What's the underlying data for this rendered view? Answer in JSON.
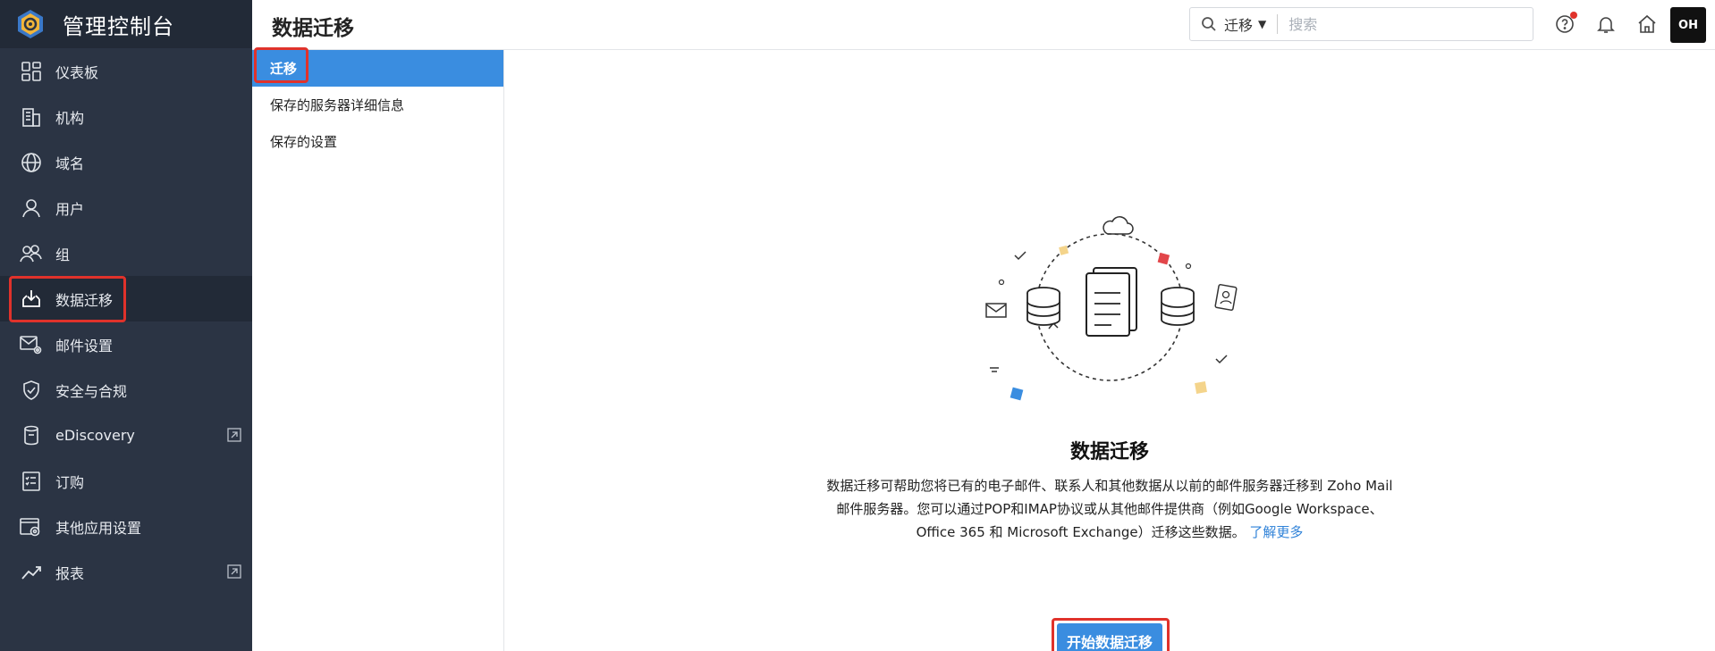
{
  "brand": {
    "title": "管理控制台"
  },
  "sidebar": {
    "items": [
      {
        "label": "仪表板",
        "icon": "dashboard-icon"
      },
      {
        "label": "机构",
        "icon": "building-icon"
      },
      {
        "label": "域名",
        "icon": "globe-icon"
      },
      {
        "label": "用户",
        "icon": "user-icon"
      },
      {
        "label": "组",
        "icon": "group-icon"
      },
      {
        "label": "数据迁移",
        "icon": "migration-icon",
        "active": true
      },
      {
        "label": "邮件设置",
        "icon": "mail-settings-icon"
      },
      {
        "label": "安全与合规",
        "icon": "shield-icon"
      },
      {
        "label": "eDiscovery",
        "icon": "ediscovery-icon",
        "external": true
      },
      {
        "label": "订购",
        "icon": "subscription-icon"
      },
      {
        "label": "其他应用设置",
        "icon": "app-settings-icon"
      },
      {
        "label": "报表",
        "icon": "reports-icon",
        "external": true
      }
    ]
  },
  "header": {
    "title": "数据迁移",
    "search": {
      "scope": "迁移",
      "placeholder": "搜索"
    },
    "avatar_text": "OH"
  },
  "subnav": {
    "items": [
      {
        "label": "迁移",
        "active": true
      },
      {
        "label": "保存的服务器详细信息"
      },
      {
        "label": "保存的设置"
      }
    ]
  },
  "main": {
    "title": "数据迁移",
    "description": "数据迁移可帮助您将已有的电子邮件、联系人和其他数据从以前的邮件服务器迁移到 Zoho Mail邮件服务器。您可以通过POP和IMAP协议或从其他邮件提供商（例如Google Workspace、Office 365 和 Microsoft Exchange）迁移这些数据。",
    "learn_more": "了解更多",
    "button": "开始数据迁移"
  },
  "colors": {
    "sidebar": "#2b3444",
    "accent": "#3a8de0",
    "highlight": "#e0322b"
  }
}
